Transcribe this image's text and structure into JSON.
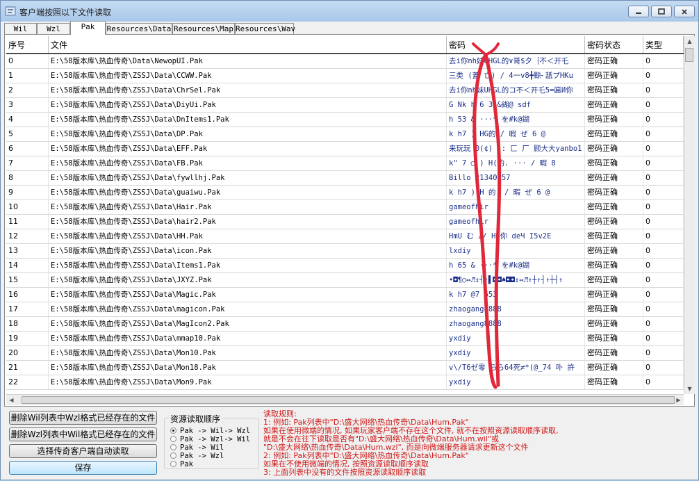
{
  "window": {
    "title": "客户端按照以下文件读取"
  },
  "tabs": [
    "Wil",
    "Wzl",
    "Pak",
    "Resources\\Data",
    "Resources\\Map",
    "Resources\\Wav"
  ],
  "active_tab": "Pak",
  "table": {
    "columns": [
      "序号",
      "文件",
      "密码",
      "密码状态",
      "类型"
    ],
    "rows": [
      {
        "no": "0",
        "file": "E:\\58版本库\\热血传奇\\Data\\NewopUI.Pak",
        "pw": "去i你nh妹UHGL的∨哥$夕｛不＜开乇",
        "status": "密码正确",
        "type": "0"
      },
      {
        "no": "1",
        "file": "E:\\58版本库\\热血传奇\\ZSSJ\\Data\\CCWW.Pak",
        "pw": "三类 (蓋 亡)  ∕  4一v8╋黥╴舐プHKu",
        "status": "密码正确",
        "type": "0"
      },
      {
        "no": "2",
        "file": "E:\\58版本库\\热血传奇\\ZSSJ\\Data\\ChrSel.Pak",
        "pw": "去i你nh妹UHGL的コ不＜开乇5=匾И你",
        "status": "密码正确",
        "type": "0"
      },
      {
        "no": "3",
        "file": "E:\\58版本库\\热血传奇\\ZSSJ\\Data\\DiyUi.Pak",
        "pw": "  G   Nk  h   6  3   &鍸@   sdf",
        "status": "密码正确",
        "type": "0"
      },
      {
        "no": "4",
        "file": "E:\\58版本库\\热血传奇\\ZSSJ\\Data\\DnItems1.Pak",
        "pw": "  h   53   &    ···*         を#k@鍸",
        "status": "密码正确",
        "type": "0"
      },
      {
        "no": "5",
        "file": "E:\\58版本库\\热血传奇\\ZSSJ\\Data\\DP.Pak",
        "pw": "k  h7     )  HG的    / 暇     ぜ    6 @",
        "status": "密码正确",
        "type": "0"
      },
      {
        "no": "6",
        "file": "E:\\58版本库\\热血传奇\\ZSSJ\\Data\\EFF.Pak",
        "pw": " 来玩玩 0(¢)  :: 匚 厂 顾大大yanbo1",
        "status": "密码正确",
        "type": "0"
      },
      {
        "no": "7",
        "file": "E:\\58版本库\\热血传奇\\ZSSJ\\Data\\FB.Pak",
        "pw": "k\"    7    ◯    )  H(的.  ···    / 暇      8",
        "status": "密码正确",
        "type": "0"
      },
      {
        "no": "8",
        "file": "E:\\58版本库\\热血传奇\\ZSSJ\\Data\\fywllhj.Pak",
        "pw": "Billo 21340757",
        "status": "密码正确",
        "type": "0"
      },
      {
        "no": "9",
        "file": "E:\\58版本库\\热血传奇\\ZSSJ\\Data\\guaiwu.Pak",
        "pw": "k   h7       )  H 的.    / 暇     ぜ    6 @",
        "status": "密码正确",
        "type": "0"
      },
      {
        "no": "10",
        "file": "E:\\58版本库\\热血传奇\\ZSSJ\\Data\\Hair.Pak",
        "pw": "gameofhir",
        "status": "密码正确",
        "type": "0"
      },
      {
        "no": "11",
        "file": "E:\\58版本库\\热血传奇\\ZSSJ\\Data\\hair2.Pak",
        "pw": "gameofhir",
        "status": "密码正确",
        "type": "0"
      },
      {
        "no": "12",
        "file": "E:\\58版本库\\热血传奇\\ZSSJ\\Data\\HH.Pak",
        "pw": "HmU む  //     HG你   deЧ I5v2Е",
        "status": "密码正确",
        "type": "0"
      },
      {
        "no": "13",
        "file": "E:\\58版本库\\热血传奇\\ZSSJ\\Data\\icon.Pak",
        "pw": "lxdiy",
        "status": "密码正确",
        "type": "0"
      },
      {
        "no": "14",
        "file": "E:\\58版本库\\热血传奇\\ZSSJ\\Data\\Items1.Pak",
        "pw": "  h   65    &     ···*         を#k@鍸",
        "status": "密码正确",
        "type": "0"
      },
      {
        "no": "15",
        "file": "E:\\58版本库\\热血传奇\\ZSSJ\\Data\\JXYZ.Pak",
        "pw": "•◘¶○↔♬↕┤↑▌◘◘♠◘◘↕↔♬↑┼↑┤↑┼┤↑",
        "status": "密码正确",
        "type": "0"
      },
      {
        "no": "16",
        "file": "E:\\58版本库\\热血传奇\\ZSSJ\\Data\\Magic.Pak",
        "pw": "k   h7              @7          653",
        "status": "密码正确",
        "type": "0"
      },
      {
        "no": "17",
        "file": "E:\\58版本库\\热血传奇\\ZSSJ\\Data\\magicon.Pak",
        "pw": "zhaogang8888",
        "status": "密码正确",
        "type": "0"
      },
      {
        "no": "18",
        "file": "E:\\58版本库\\热血传奇\\ZSSJ\\Data\\MagIcon2.Pak",
        "pw": "zhaogang8888",
        "status": "密码正确",
        "type": "0"
      },
      {
        "no": "19",
        "file": "E:\\58版本库\\热血传奇\\ZSSJ\\Data\\mmap10.Pak",
        "pw": "yxdiy",
        "status": "密码正确",
        "type": "0"
      },
      {
        "no": "20",
        "file": "E:\\58版本库\\热血传奇\\ZSSJ\\Data\\Mon10.Pak",
        "pw": "yxdiy",
        "status": "密码正确",
        "type": "0"
      },
      {
        "no": "21",
        "file": "E:\\58版本库\\热血传奇\\ZSSJ\\Data\\Mon18.Pak",
        "pw": "v\\∕T6ゼ零   らら64死≠*(@_74 卟   許",
        "status": "密码正确",
        "type": "0"
      },
      {
        "no": "22",
        "file": "E:\\58版本库\\热血传奇\\ZSSJ\\Data\\Mon9.Pak",
        "pw": "yxdiy",
        "status": "密码正确",
        "type": "0"
      }
    ]
  },
  "buttons": {
    "delete_wil": "删除Wil列表中Wzl格式已经存在的文件",
    "delete_wzl": "删除Wzl列表中Wil格式已经存在的文件",
    "auto_read": "选择传奇客户端自动读取",
    "save": "保存"
  },
  "resource_order": {
    "title": "资源读取顺序",
    "options": [
      "Pak -> Wil-> Wzl",
      "Pak -> Wzl-> Wil",
      "Pak -> Wil",
      "Pak -> Wzl",
      "Pak"
    ],
    "selected_index": 0
  },
  "rules": [
    "读取规则:",
    "1: 例如: Pak列表中\"D:\\盛大网络\\热血传奇\\Data\\Hum.Pak\"",
    "    如果在使用微端的情况, 如果玩家客户端不存在这个文件, 就不在按照资源读取顺序读取,",
    "    就是不会在往下读取是否有\"D:\\盛大网络\\热血传奇\\Data\\Hum.wil\"或",
    "    \"D:\\盛大网络\\热血传奇\\Data\\Hum.wzl\", 而是向微端服务器请求更新这个文件",
    "2: 例如: Pak列表中\"D:\\盛大网络\\热血传奇\\Data\\Hum.Pak\"",
    "    如果在不使用微端的情况, 按照资源读取顺序读取",
    "3: 上面列表中没有的文件按照资源读取顺序读取"
  ],
  "colors": {
    "rules_text": "#d01818",
    "password_text": "#1a2f88",
    "annotation_stroke": "#e0283a"
  },
  "icons": [
    "app-icon",
    "minimize-icon",
    "maximize-icon",
    "close-icon",
    "scroll-up-icon",
    "scroll-down-icon",
    "scroll-left-icon",
    "scroll-right-icon"
  ]
}
